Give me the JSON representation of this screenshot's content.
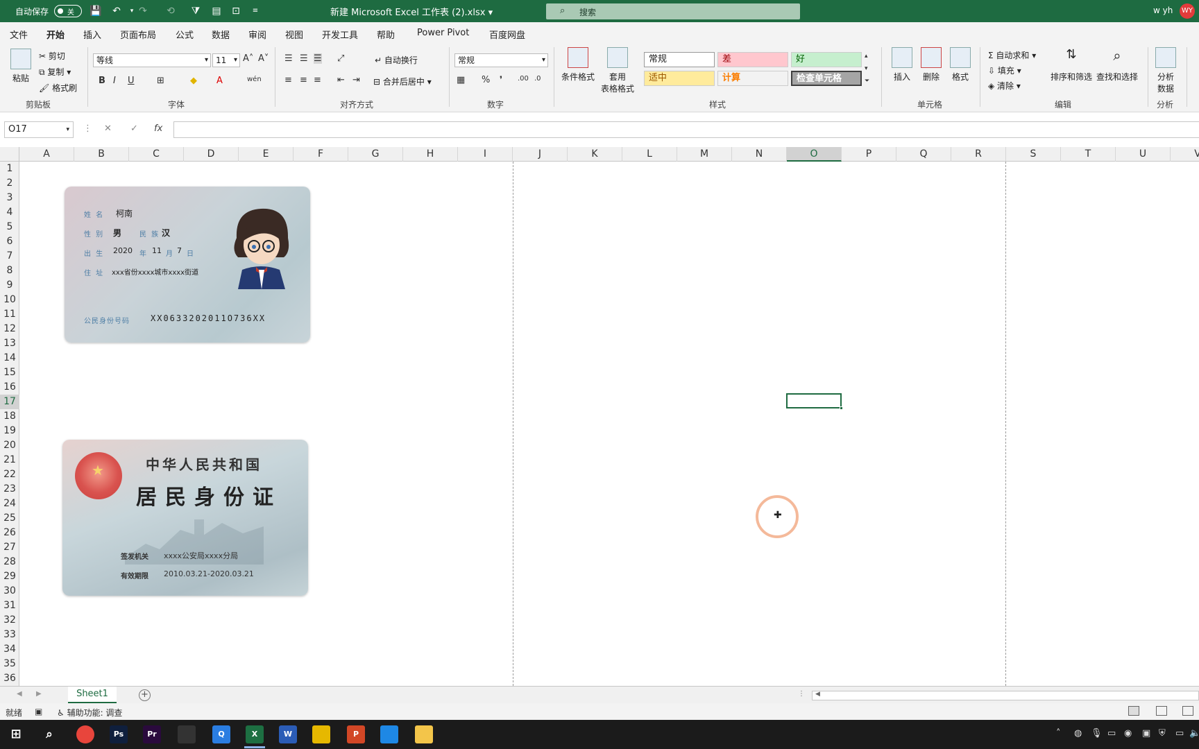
{
  "titlebar": {
    "autosave_label": "自动保存",
    "autosave_state": "关",
    "doc_title": "新建 Microsoft Excel 工作表 (2).xlsx",
    "search_placeholder": "搜索",
    "user_name": "w yh",
    "user_initials": "WY"
  },
  "menu_tabs": [
    "文件",
    "开始",
    "插入",
    "页面布局",
    "公式",
    "数据",
    "审阅",
    "视图",
    "开发工具",
    "帮助",
    "Power Pivot",
    "百度网盘"
  ],
  "active_tab": "开始",
  "ribbon": {
    "clipboard": {
      "paste": "粘贴",
      "cut": "剪切",
      "copy": "复制",
      "format_painter": "格式刷",
      "label": "剪贴板"
    },
    "font": {
      "name": "等线",
      "size": "11",
      "label": "字体"
    },
    "alignment": {
      "wrap": "自动换行",
      "merge": "合并后居中",
      "label": "对齐方式"
    },
    "number": {
      "format": "常规",
      "label": "数字"
    },
    "styles": {
      "conditional": "条件格式",
      "table_format_1": "套用",
      "table_format_2": "表格格式",
      "cells": [
        {
          "text": "常规",
          "bg": "#ffffff",
          "fg": "#222222"
        },
        {
          "text": "差",
          "bg": "#ffc7ce",
          "fg": "#9c0006"
        },
        {
          "text": "好",
          "bg": "#c6efce",
          "fg": "#006100"
        },
        {
          "text": "适中",
          "bg": "#ffeb9c",
          "fg": "#9c5700"
        },
        {
          "text": "计算",
          "bg": "#f2f2f2",
          "fg": "#fa7d00"
        },
        {
          "text": "检查单元格",
          "bg": "#a5a5a5",
          "fg": "#ffffff"
        }
      ],
      "label": "样式"
    },
    "cells": {
      "insert": "插入",
      "delete": "删除",
      "format": "格式",
      "label": "单元格"
    },
    "editing": {
      "autosum": "自动求和",
      "fill": "填充",
      "clear": "清除",
      "sort": "排序和筛选",
      "find": "查找和选择",
      "label": "编辑"
    },
    "analysis": {
      "analyze_1": "分析",
      "analyze_2": "数据",
      "label": "分析"
    }
  },
  "formula_bar": {
    "name_box": "O17",
    "fx": "fx",
    "cancel": "✕",
    "enter": "✓"
  },
  "columns": [
    "A",
    "B",
    "C",
    "D",
    "E",
    "F",
    "G",
    "H",
    "I",
    "J",
    "K",
    "L",
    "M",
    "N",
    "O",
    "P",
    "Q",
    "R",
    "S",
    "T",
    "U",
    "V"
  ],
  "selected_column": "O",
  "rows": [
    "1",
    "2",
    "3",
    "4",
    "5",
    "6",
    "7",
    "8",
    "9",
    "10",
    "11",
    "12",
    "13",
    "14",
    "15",
    "16",
    "17",
    "18",
    "19",
    "20",
    "21",
    "22",
    "23",
    "24",
    "25",
    "26",
    "27",
    "28",
    "29",
    "30",
    "31",
    "32",
    "33",
    "34",
    "35",
    "36"
  ],
  "selected_row": "17",
  "id_front": {
    "name_label": "姓 名",
    "name": "柯南",
    "sex_label": "性 别",
    "sex": "男",
    "ethnic_label": "民 族",
    "ethnic": "汉",
    "birth_label": "出 生",
    "birth_year": "2020",
    "birth_y_unit": "年",
    "birth_month": "11",
    "birth_m_unit": "月",
    "birth_day": "7",
    "birth_d_unit": "日",
    "address_label": "住 址",
    "address": "xxx省份xxxx城市xxxx街道",
    "id_label": "公民身份号码",
    "id_number": "XX0633202011O736XX"
  },
  "id_back": {
    "title1": "中华人民共和国",
    "title2": "居民身份证",
    "authority_label": "签发机关",
    "authority": "xxxx公安局xxxx分局",
    "validity_label": "有效期限",
    "validity": "2010.03.21-2020.03.21"
  },
  "sheet_tabs": [
    "Sheet1"
  ],
  "status": {
    "ready": "就绪",
    "accessibility": "辅助功能: 调查"
  },
  "taskbar_apps": [
    {
      "name": "chrome-icon",
      "color": "#e8453c",
      "label": ""
    },
    {
      "name": "photoshop-icon",
      "color": "#0f1f3d",
      "label": "Ps"
    },
    {
      "name": "premiere-icon",
      "color": "#2a0a3d",
      "label": "Pr"
    },
    {
      "name": "terminal-icon",
      "color": "#333333",
      "label": ""
    },
    {
      "name": "qq-icon",
      "color": "#2a7de1",
      "label": "Q"
    },
    {
      "name": "excel-icon",
      "color": "#1d6f42",
      "label": "X"
    },
    {
      "name": "word-icon",
      "color": "#2b5cb6",
      "label": "W"
    },
    {
      "name": "powerbi-icon",
      "color": "#e6b800",
      "label": ""
    },
    {
      "name": "powerpoint-icon",
      "color": "#d24726",
      "label": "P"
    },
    {
      "name": "video-icon",
      "color": "#1e88e5",
      "label": ""
    },
    {
      "name": "explorer-icon",
      "color": "#f3c54a",
      "label": ""
    }
  ],
  "active_taskbar_app": "excel-icon"
}
